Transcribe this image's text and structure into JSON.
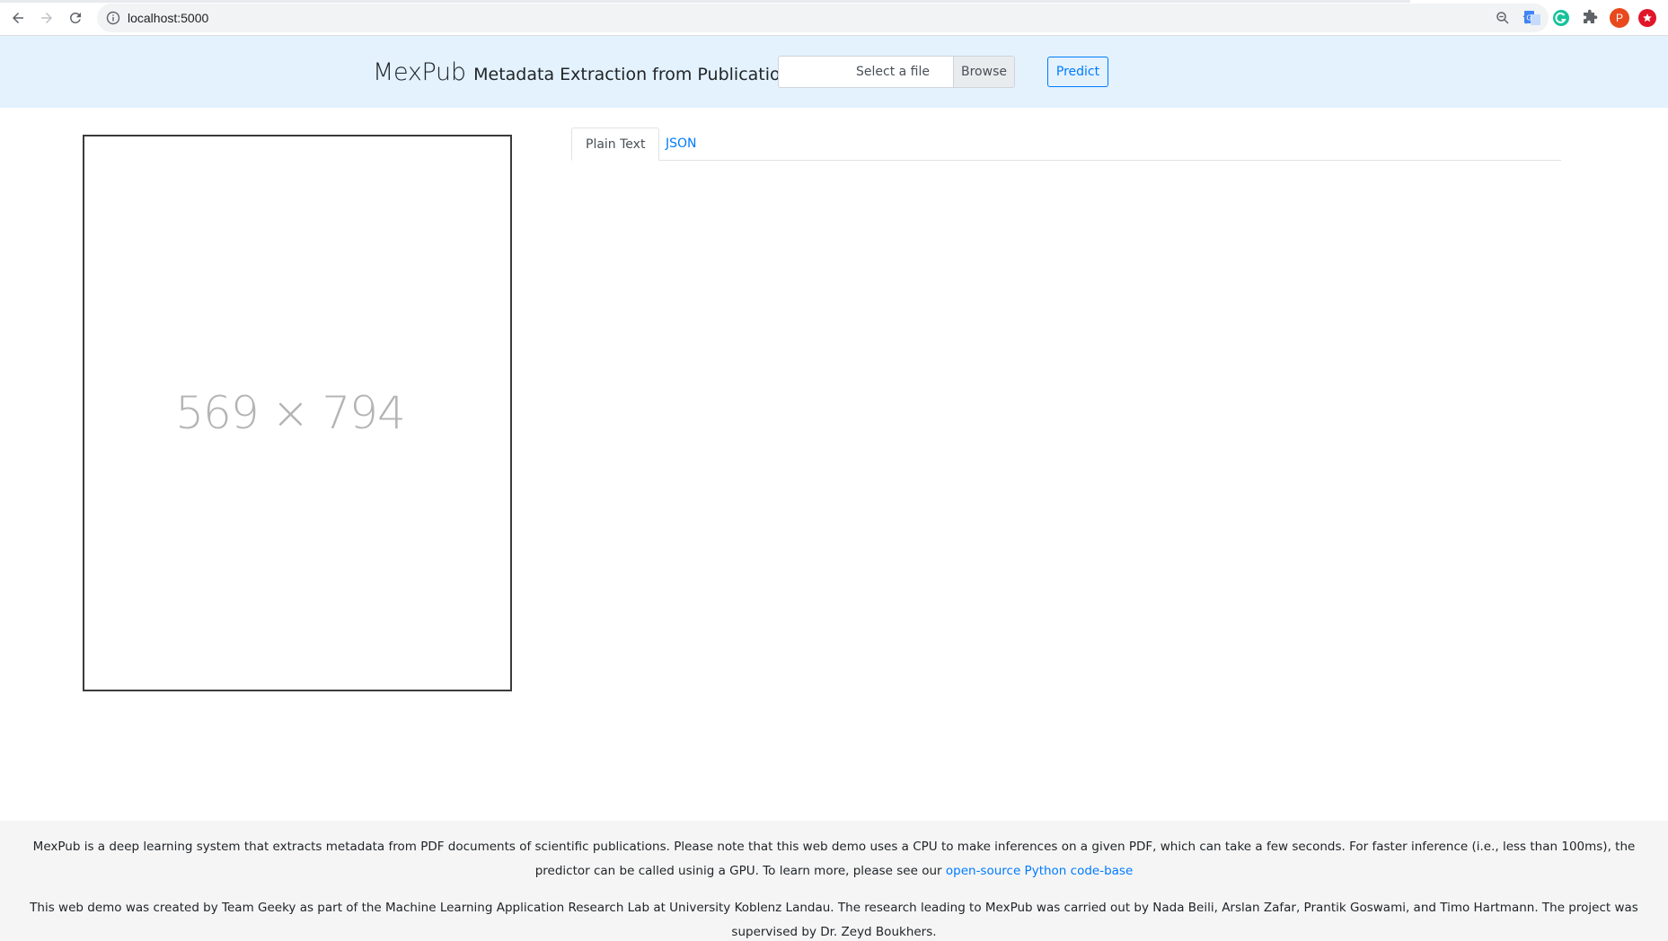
{
  "browser": {
    "url": "localhost:5000",
    "profile_initial": "P",
    "icons": [
      "back-icon",
      "forward-icon",
      "reload-icon",
      "info-icon",
      "zoom-icon",
      "star-icon",
      "translate-extension-icon",
      "grammarly-extension-icon",
      "puzzle-extensions-icon",
      "profile-avatar",
      "alert-extension-icon"
    ]
  },
  "header": {
    "app_name": "MexPub",
    "app_subtitle": "Metadata Extraction from Publications",
    "file_placeholder": "Select a file",
    "browse_label": "Browse",
    "predict_label": "Predict",
    "background_color": "#e3f2fd",
    "accent_color": "#007bff"
  },
  "preview": {
    "placeholder_text": "569 × 794"
  },
  "tabs": [
    {
      "label": "Plain Text",
      "active": true
    },
    {
      "label": "JSON",
      "active": false
    }
  ],
  "footer": {
    "paragraph1_text": "MexPub is a deep learning system that extracts metadata from PDF documents of scientific publications. Please note that this web demo uses a CPU to make inferences on a given PDF, which can take a few seconds. For faster inference (i.e., less than 100ms), the predictor can be called usinig a GPU. To learn more, please see our ",
    "paragraph1_link": "open-source Python code-base",
    "paragraph2_text": "This web demo was created by Team Geeky as part of the Machine Learning Application Research Lab at University Koblenz Landau. The research leading to MexPub was carried out by Nada Beili, Arslan Zafar, Prantik Goswami, and Timo Hartmann. The project was supervised by Dr. Zeyd Boukhers."
  }
}
